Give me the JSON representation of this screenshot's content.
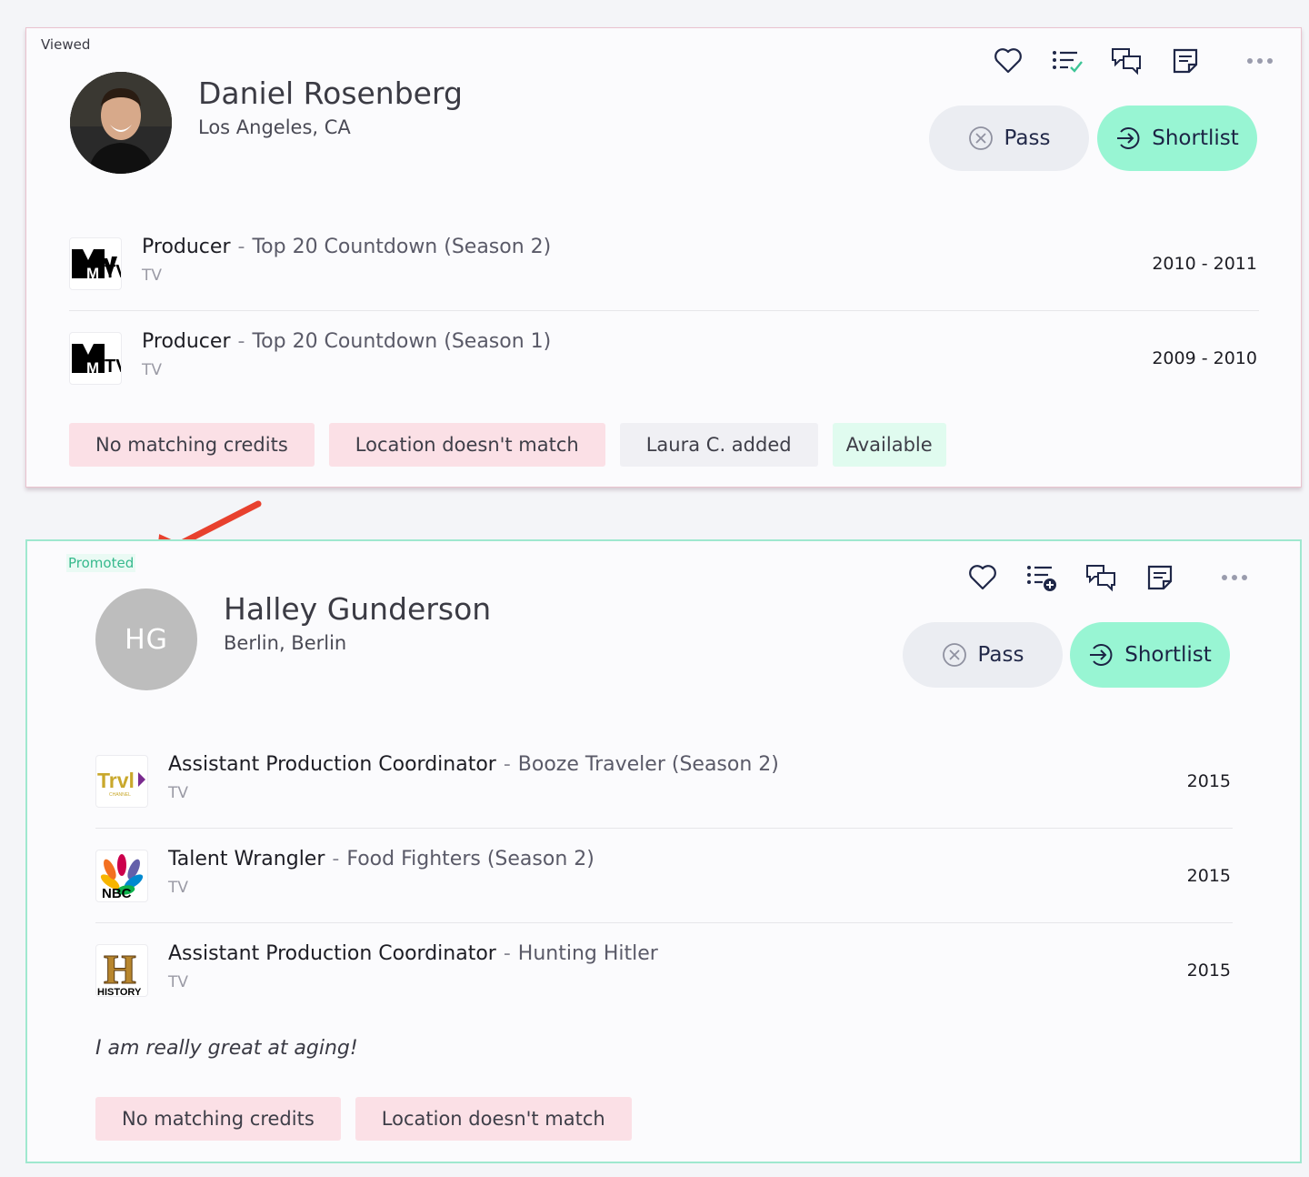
{
  "colors": {
    "accent_green": "#98f5d3",
    "pass_bg": "#ebedf2",
    "tag_red": "#fbe0e6",
    "tag_green": "#e0fbef",
    "arrow_red": "#e8412e"
  },
  "candidates": [
    {
      "status": "Viewed",
      "name": "Daniel Rosenberg",
      "location": "Los Angeles, CA",
      "actions": {
        "pass": "Pass",
        "shortlist": "Shortlist"
      },
      "credits": [
        {
          "role": "Producer",
          "show": "Top 20 Countdown (Season 2)",
          "type": "TV",
          "years": "2010 - 2011",
          "logo": "MTV"
        },
        {
          "role": "Producer",
          "show": "Top 20 Countdown (Season 1)",
          "type": "TV",
          "years": "2009 - 2010",
          "logo": "MTV"
        }
      ],
      "tags": [
        "No matching credits",
        "Location doesn't match",
        "Laura C. added",
        "Available"
      ]
    },
    {
      "status": "Promoted",
      "initials": "HG",
      "name": "Halley Gunderson",
      "location": "Berlin, Berlin",
      "actions": {
        "pass": "Pass",
        "shortlist": "Shortlist"
      },
      "credits": [
        {
          "role": "Assistant Production Coordinator",
          "show": "Booze Traveler (Season 2)",
          "type": "TV",
          "years": "2015",
          "logo": "Trvl"
        },
        {
          "role": "Talent Wrangler",
          "show": "Food Fighters (Season 2)",
          "type": "TV",
          "years": "2015",
          "logo": "NBC"
        },
        {
          "role": "Assistant Production Coordinator",
          "show": "Hunting Hitler",
          "type": "TV",
          "years": "2015",
          "logo": "HISTORY"
        }
      ],
      "quote": "I am really great at aging!",
      "tags": [
        "No matching credits",
        "Location doesn't match"
      ]
    }
  ]
}
